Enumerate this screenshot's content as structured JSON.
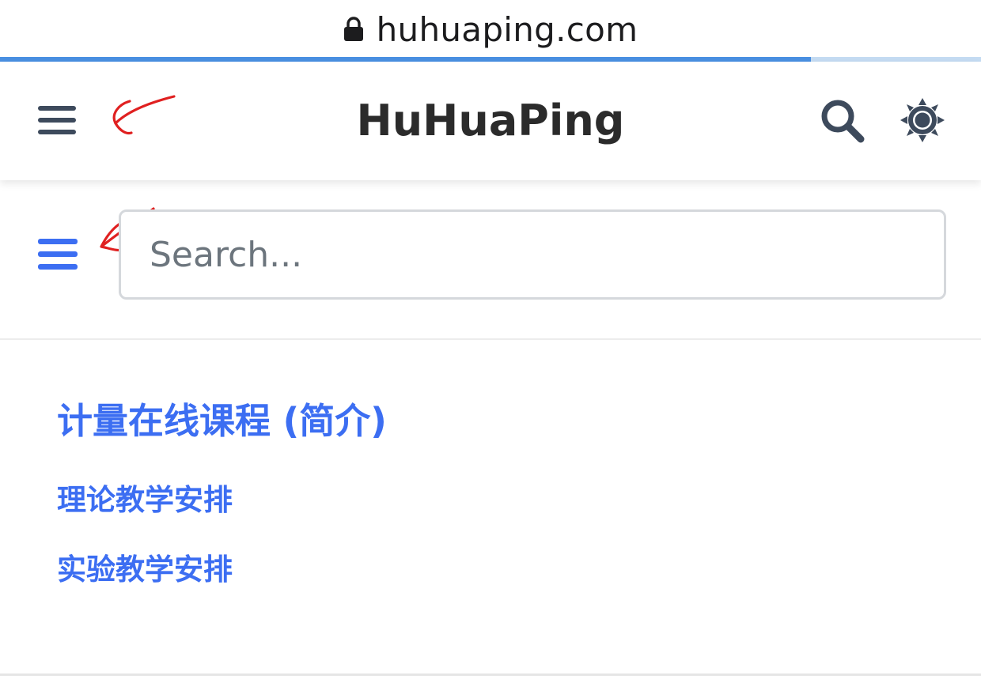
{
  "browser": {
    "url": "huhuaping.com",
    "load_progress": 0.827,
    "progress_color": "#4a90e2",
    "progress_track_color": "#c5dcf3"
  },
  "header": {
    "title": "HuHuaPing",
    "menu_icon": "hamburger-menu-icon",
    "search_icon": "search-icon",
    "settings_icon": "gear-icon"
  },
  "sidebar": {
    "menu_icon": "hamburger-menu-icon",
    "search": {
      "placeholder": "Search...",
      "value": ""
    },
    "heading": "计量在线课程 (简介)",
    "items": [
      {
        "label": "理论教学安排"
      },
      {
        "label": "实验教学安排"
      }
    ]
  },
  "colors": {
    "accent": "#3c6ef2",
    "header_icon": "#3d4a5c",
    "annotation": "#e02020",
    "title": "#2b2b2b"
  }
}
